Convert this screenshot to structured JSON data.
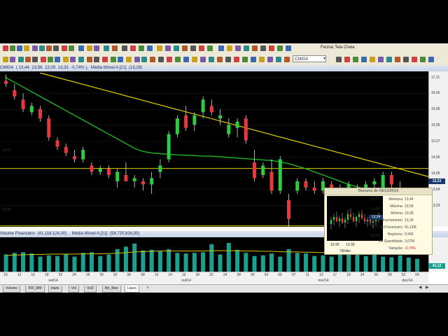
{
  "toolbar": {
    "fullscreen_label": "Fechar Tela Cheia",
    "ticker_value": "CMIG4",
    "icon_colors": [
      "#d04040",
      "#4a8a3a",
      "#3a6ab0",
      "#c8a020",
      "#7a5aa8",
      "#2a8a8a",
      "#b05a2a",
      "#555555"
    ]
  },
  "price_panel": {
    "ticker": "CMIG4",
    "open": "13,44",
    "high": "13,58",
    "low": "13,09",
    "close": "13,33",
    "change": "-0,74%",
    "ma_label": "Média Móvel A [21]",
    "ma_value": "(13,28)",
    "axis_ticks": [
      "17,11",
      "16,60",
      "16,09",
      "15,58",
      "15,07",
      "14,56",
      "14,05",
      "13,54",
      "13,03"
    ],
    "last_price_badge": "13,33",
    "hline_high": "14,21",
    "hline_low": "12,38"
  },
  "volume_panel": {
    "title": "Volume Financeiro",
    "value": "(41.118.124,00)",
    "ma_label": "Média Móvel A [21]",
    "ma_value": "(58.720.816,00)",
    "last_badge": "41,12"
  },
  "date_axis": {
    "days": [
      "10",
      "12",
      "16",
      "18",
      "22",
      "24",
      "26",
      "30",
      "02",
      "06",
      "08",
      "10",
      "14",
      "16",
      "20",
      "22",
      "24",
      "28",
      "30",
      "03",
      "05",
      "07",
      "11",
      "13",
      "17",
      "19",
      "24",
      "26",
      "28",
      "02",
      "04"
    ],
    "months": [
      "set/14",
      "out/14",
      "nov/14",
      "dez/14"
    ]
  },
  "tabs": [
    {
      "label": "Volume",
      "active": false
    },
    {
      "label": "IFR_MM",
      "active": false
    },
    {
      "label": "blank",
      "active": false
    },
    {
      "label": "Vol",
      "active": false
    },
    {
      "label": "Vol2",
      "active": false
    },
    {
      "label": "Mn_Max",
      "active": false
    },
    {
      "label": "Lauro",
      "active": true
    }
  ],
  "popup": {
    "title": "Resumo de 05/12/2014",
    "mini_ticks": [
      "13,57",
      "13,45",
      "13,34",
      "13,21",
      "13,09"
    ],
    "mini_badge": "13,34",
    "mini_times": [
      "10:30",
      "13:30"
    ],
    "mini_date": "05/dez",
    "rows": [
      {
        "key": "Abertura:",
        "value": "13,44",
        "negative": false
      },
      {
        "key": "Máxima:",
        "value": "13,58",
        "negative": false
      },
      {
        "key": "Mínima:",
        "value": "13,09",
        "negative": false
      },
      {
        "key": "Fechamento:",
        "value": "13,33",
        "negative": false
      },
      {
        "key": "Vol Financeiro:",
        "value": "41,12M",
        "negative": false
      },
      {
        "key": "Negócios:",
        "value": "9.366",
        "negative": false
      },
      {
        "key": "Vol Quantidade:",
        "value": "3,07M",
        "negative": false
      },
      {
        "key": "Variação:",
        "value": "-0,74%",
        "negative": true
      }
    ]
  },
  "chart_data": [
    {
      "type": "candlestick",
      "title": "CMIG4",
      "colors": {
        "up": "#2ecc40",
        "down": "#e8383d",
        "ma": "#22b522",
        "trend": "#e0d000",
        "hline": "#e0d000"
      },
      "y_axis_ticks": [
        17.11,
        16.6,
        16.09,
        15.58,
        15.07,
        14.56,
        14.05,
        13.54,
        13.03
      ],
      "ylim": [
        12.35,
        17.3
      ],
      "moving_average_21": [
        17.1,
        16.95,
        16.8,
        16.65,
        16.5,
        16.35,
        16.2,
        16.05,
        15.9,
        15.75,
        15.6,
        15.45,
        15.3,
        15.15,
        15.0,
        14.85,
        14.75,
        14.7,
        14.68,
        14.66,
        14.64,
        14.63,
        14.62,
        14.6,
        14.6,
        14.58,
        14.56,
        14.54,
        14.52,
        14.5,
        14.48,
        14.46,
        14.42,
        14.36,
        14.28,
        14.2,
        14.1,
        14.0,
        13.9,
        13.8,
        13.7,
        13.62,
        13.56,
        13.5,
        13.45,
        13.42,
        13.38,
        13.35,
        13.32
      ],
      "candles": [
        {
          "o": 17.0,
          "h": 17.2,
          "l": 16.8,
          "c": 16.9
        },
        {
          "o": 16.7,
          "h": 16.9,
          "l": 16.4,
          "c": 16.5
        },
        {
          "o": 16.4,
          "h": 16.6,
          "l": 16.0,
          "c": 16.1
        },
        {
          "o": 16.0,
          "h": 16.3,
          "l": 15.9,
          "c": 16.2
        },
        {
          "o": 16.1,
          "h": 16.2,
          "l": 15.7,
          "c": 15.8
        },
        {
          "o": 15.8,
          "h": 15.9,
          "l": 15.1,
          "c": 15.2
        },
        {
          "o": 15.1,
          "h": 15.2,
          "l": 14.8,
          "c": 14.9
        },
        {
          "o": 14.9,
          "h": 15.0,
          "l": 14.6,
          "c": 14.7
        },
        {
          "o": 14.6,
          "h": 14.8,
          "l": 14.4,
          "c": 14.5
        },
        {
          "o": 14.5,
          "h": 14.9,
          "l": 14.4,
          "c": 14.8
        },
        {
          "o": 14.3,
          "h": 14.4,
          "l": 14.0,
          "c": 14.1
        },
        {
          "o": 14.1,
          "h": 14.3,
          "l": 14.0,
          "c": 14.2
        },
        {
          "o": 14.2,
          "h": 14.3,
          "l": 13.9,
          "c": 14.0
        },
        {
          "o": 13.8,
          "h": 14.2,
          "l": 13.6,
          "c": 14.1
        },
        {
          "o": 14.0,
          "h": 14.4,
          "l": 13.8,
          "c": 13.8
        },
        {
          "o": 13.8,
          "h": 14.0,
          "l": 13.6,
          "c": 13.9
        },
        {
          "o": 13.8,
          "h": 13.9,
          "l": 13.5,
          "c": 13.7
        },
        {
          "o": 13.7,
          "h": 14.1,
          "l": 13.4,
          "c": 13.9
        },
        {
          "o": 14.1,
          "h": 14.5,
          "l": 13.9,
          "c": 14.3
        },
        {
          "o": 14.5,
          "h": 15.4,
          "l": 14.4,
          "c": 15.3
        },
        {
          "o": 15.3,
          "h": 15.9,
          "l": 15.2,
          "c": 15.8
        },
        {
          "o": 15.9,
          "h": 16.2,
          "l": 15.4,
          "c": 15.5
        },
        {
          "o": 15.6,
          "h": 16.0,
          "l": 15.4,
          "c": 15.9
        },
        {
          "o": 16.0,
          "h": 16.5,
          "l": 15.8,
          "c": 16.4
        },
        {
          "o": 16.2,
          "h": 16.4,
          "l": 15.9,
          "c": 16.0
        },
        {
          "o": 15.8,
          "h": 16.1,
          "l": 15.6,
          "c": 15.9
        },
        {
          "o": 15.3,
          "h": 15.8,
          "l": 15.2,
          "c": 15.6
        },
        {
          "o": 15.5,
          "h": 15.8,
          "l": 15.2,
          "c": 15.7
        },
        {
          "o": 15.8,
          "h": 15.9,
          "l": 15.0,
          "c": 15.1
        },
        {
          "o": 14.4,
          "h": 14.8,
          "l": 13.8,
          "c": 13.9
        },
        {
          "o": 14.0,
          "h": 14.4,
          "l": 13.9,
          "c": 14.3
        },
        {
          "o": 14.1,
          "h": 14.5,
          "l": 13.4,
          "c": 13.5
        },
        {
          "o": 13.5,
          "h": 14.6,
          "l": 13.4,
          "c": 14.5
        },
        {
          "o": 13.2,
          "h": 13.4,
          "l": 12.3,
          "c": 12.6
        },
        {
          "o": 13.5,
          "h": 13.9,
          "l": 13.4,
          "c": 13.8
        },
        {
          "o": 13.8,
          "h": 13.9,
          "l": 13.5,
          "c": 13.6
        },
        {
          "o": 13.6,
          "h": 13.8,
          "l": 13.4,
          "c": 13.5
        },
        {
          "o": 13.5,
          "h": 13.9,
          "l": 13.4,
          "c": 13.8
        },
        {
          "o": 13.7,
          "h": 13.8,
          "l": 13.4,
          "c": 13.5
        },
        {
          "o": 13.6,
          "h": 13.7,
          "l": 13.3,
          "c": 13.4
        },
        {
          "o": 13.4,
          "h": 13.8,
          "l": 13.3,
          "c": 13.7
        },
        {
          "o": 13.6,
          "h": 13.7,
          "l": 13.2,
          "c": 13.3
        },
        {
          "o": 13.4,
          "h": 13.8,
          "l": 13.3,
          "c": 13.7
        },
        {
          "o": 13.7,
          "h": 13.9,
          "l": 13.6,
          "c": 13.8
        },
        {
          "o": 13.6,
          "h": 14.1,
          "l": 13.5,
          "c": 14.0
        },
        {
          "o": 14.0,
          "h": 14.1,
          "l": 13.6,
          "c": 13.7
        },
        {
          "o": 13.6,
          "h": 13.8,
          "l": 13.3,
          "c": 13.4
        },
        {
          "o": 13.3,
          "h": 13.5,
          "l": 13.1,
          "c": 13.2
        },
        {
          "o": 13.4,
          "h": 13.6,
          "l": 13.2,
          "c": 13.3
        }
      ]
    },
    {
      "type": "bar",
      "title": "Volume Financeiro",
      "values": [
        55,
        60,
        62,
        58,
        48,
        52,
        50,
        56,
        48,
        60,
        62,
        50,
        55,
        72,
        80,
        90,
        68,
        70,
        66,
        72,
        60,
        58,
        60,
        62,
        88,
        55,
        92,
        70,
        60,
        50,
        52,
        58,
        48,
        72,
        60,
        58,
        50,
        52,
        48,
        60,
        66,
        58,
        50,
        54,
        48,
        46,
        52,
        45,
        41
      ],
      "moving_average_21": [
        52,
        53,
        54,
        55,
        55,
        56,
        56,
        56,
        56,
        57,
        57,
        57,
        58,
        59,
        61,
        63,
        64,
        65,
        66,
        66,
        66,
        66,
        66,
        66,
        67,
        67,
        67,
        67,
        66,
        66,
        65,
        65,
        64,
        63,
        63,
        62,
        62,
        61,
        61,
        60,
        60,
        59,
        59,
        58,
        58,
        57,
        57,
        56,
        56
      ],
      "colors": {
        "bar": "#1aa090",
        "ma": "#d6c400"
      },
      "ylim": [
        0,
        110
      ]
    }
  ]
}
